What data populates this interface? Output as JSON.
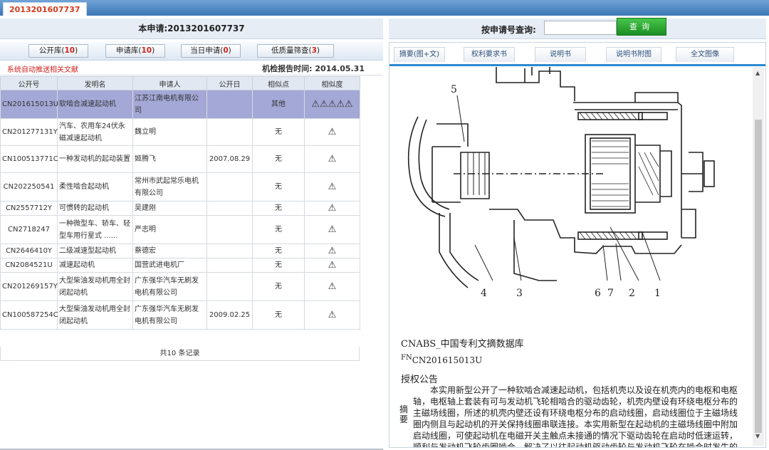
{
  "top_tab": "2013201607737",
  "left": {
    "header": "本申请:2013201607737",
    "libraries": [
      {
        "label": "公开库(",
        "count": "10",
        "close": ")"
      },
      {
        "label": "申请库(",
        "count": "10",
        "close": ")"
      },
      {
        "label": "当日申请(",
        "count": "0",
        "close": ")"
      },
      {
        "label": "低质量筛查(",
        "count": "3",
        "close": ")"
      }
    ],
    "auto_push": "系统自动推送相关文献",
    "report_time_label": "机检报告时间:",
    "report_time": "2014.05.31",
    "columns": [
      "公开号",
      "发明名",
      "申请人",
      "公开日",
      "相似点",
      "相似度"
    ],
    "rows": [
      {
        "pub": "CN201615013U",
        "name": "软啮合减速起动机",
        "applicant": "江苏江南电机有限公司",
        "date": "",
        "point": "其他",
        "sim": "⚠⚠⚠⚠⚠"
      },
      {
        "pub": "CN201277131Y",
        "name": "汽车、农用车24伏永磁减速起动机",
        "applicant": "魏立明",
        "date": "",
        "point": "无",
        "sim": "⚠"
      },
      {
        "pub": "CN100513771C",
        "name": "一种发动机的起动装置",
        "applicant": "姬腾飞",
        "date": "2007.08.29",
        "point": "无",
        "sim": "⚠"
      },
      {
        "pub": "CN202250541",
        "name": "柔性啮合起动机",
        "applicant": "常州市武起常乐电机有限公司",
        "date": "",
        "point": "无",
        "sim": "⚠"
      },
      {
        "pub": "CN2557712Y",
        "name": "可惯转的起动机",
        "applicant": "吴建刚",
        "date": "",
        "point": "无",
        "sim": "⚠"
      },
      {
        "pub": "CN2718247",
        "name": "一种微型车、轿车、轻型车用行星式 ......",
        "applicant": "严志明",
        "date": "",
        "point": "无",
        "sim": "⚠"
      },
      {
        "pub": "CN2646410Y",
        "name": "二级减速型起动机",
        "applicant": "蔡德宏",
        "date": "",
        "point": "无",
        "sim": "⚠"
      },
      {
        "pub": "CN2084521U",
        "name": "减速起动机",
        "applicant": "国营武进电机厂",
        "date": "",
        "point": "无",
        "sim": "⚠"
      },
      {
        "pub": "CN201269157Y",
        "name": "大型柴油发动机用全封闭起动机",
        "applicant": "广东强华汽车无刷发电机有限公司",
        "date": "",
        "point": "无",
        "sim": "⚠"
      },
      {
        "pub": "CN100587254C",
        "name": "大型柴油发动机用全封闭起动机",
        "applicant": "广东强华汽车无刷发电机有限公司",
        "date": "2009.02.25",
        "point": "无",
        "sim": "⚠"
      }
    ],
    "total": "共10 条记录"
  },
  "right": {
    "query_label": "按申请号查询:",
    "query_value": "",
    "query_button": "查询",
    "tabs": [
      "摘要(图+文)",
      "权利要求书",
      "说明书",
      "说明书附图",
      "全文图像"
    ],
    "figure_labels": [
      "5",
      "4",
      "3",
      "6",
      "7",
      "2",
      "1"
    ],
    "database": "CNABS_中国专利文摘数据库",
    "fn_label": "FN",
    "fn_value": "CN201615013U",
    "announce": "授权公告",
    "abstract_label": "摘要",
    "abstract": "本实用新型公开了一种软啮合减速起动机，包括机壳以及设在机壳内的电枢和电枢轴，电枢轴上套装有可与发动机飞轮相啮合的驱动齿轮，机壳内壁设有环绕电枢分布的主磁场线圈，所述的机壳内壁还设有环绕电枢分布的启动线圈，启动线圈位于主磁场线圈内侧且与起动机的开关保持线圈串联连接。本实用新型在起动机的主磁场线圈中附加启动线圈，可使起动机在电磁开关主触点未接通的情况下驱动齿轮在启动时低速运转，顺利与发动机飞轮齿圈啮合，解决了以往起动机驱动齿轮与发动机飞轮在啮合时发生的顶齿或铣齿现象，有效保证了起动机的使用寿命。"
  },
  "colors": {
    "accent": "#2c8ad0",
    "warn": "#e8262a",
    "selected_row": "#a3a8d6",
    "query_button": "#2fa334"
  }
}
